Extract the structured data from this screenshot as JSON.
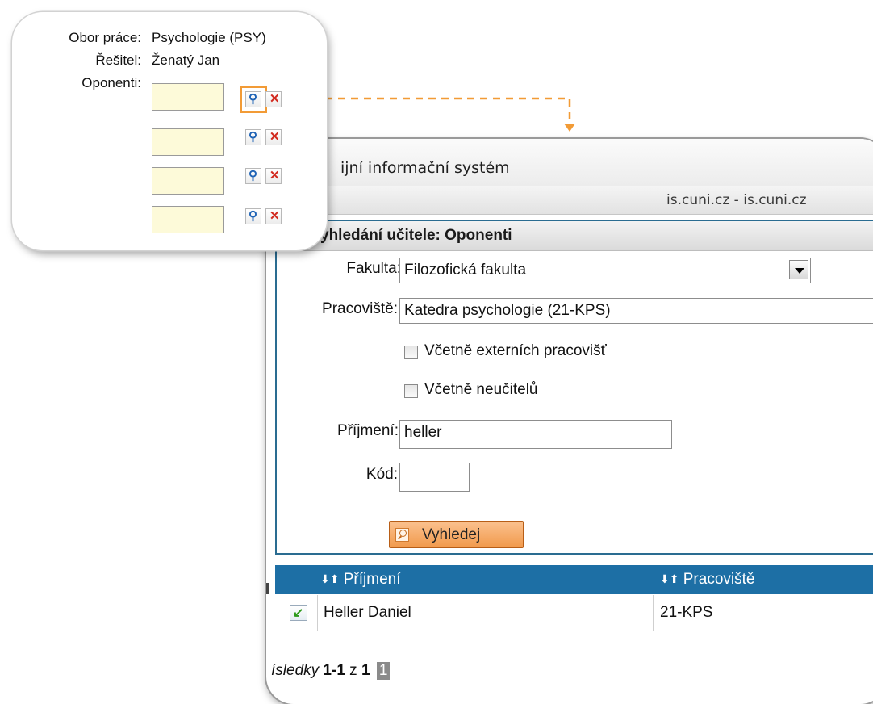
{
  "window": {
    "title": "ijní informační systém",
    "url": "is.cuni.cz - is.cuni.cz"
  },
  "search_panel": {
    "title": "yhledání učitele: Oponenti",
    "faculty_label": "Fakulta:",
    "faculty_value": "Filozofická fakulta",
    "department_label": "Pracoviště:",
    "department_value": "Katedra psychologie (21-KPS)",
    "include_external_label": "Včetně externích pracovišť",
    "include_external_checked": false,
    "include_nonteachers_label": "Včetně neučitelů",
    "include_nonteachers_checked": false,
    "surname_label": "Příjmení:",
    "surname_value": "heller",
    "code_label": "Kód:",
    "code_value": "",
    "search_button": "Vyhledej"
  },
  "results": {
    "columns": [
      "Příjmení",
      "Pracoviště"
    ],
    "sort_arrows": "⬇⬆",
    "rows": [
      {
        "name": "Heller Daniel",
        "department": "21-KPS"
      }
    ],
    "pager": {
      "label": "ísledky",
      "range": "1-1",
      "of_word": "z",
      "total": "1",
      "current_page": "1"
    }
  },
  "thesis_form": {
    "field_label": "Obor práce:",
    "field_value": "Psychologie (PSY)",
    "author_label": "Řešitel:",
    "author_value": "Ženatý Jan",
    "opponents_label": "Oponenti:",
    "opponent_slots": 4
  },
  "colors": {
    "accent_orange": "#f29b36",
    "header_blue": "#1d6fa5",
    "input_yellow": "#fdfad9",
    "panel_border": "#2a6c91"
  }
}
